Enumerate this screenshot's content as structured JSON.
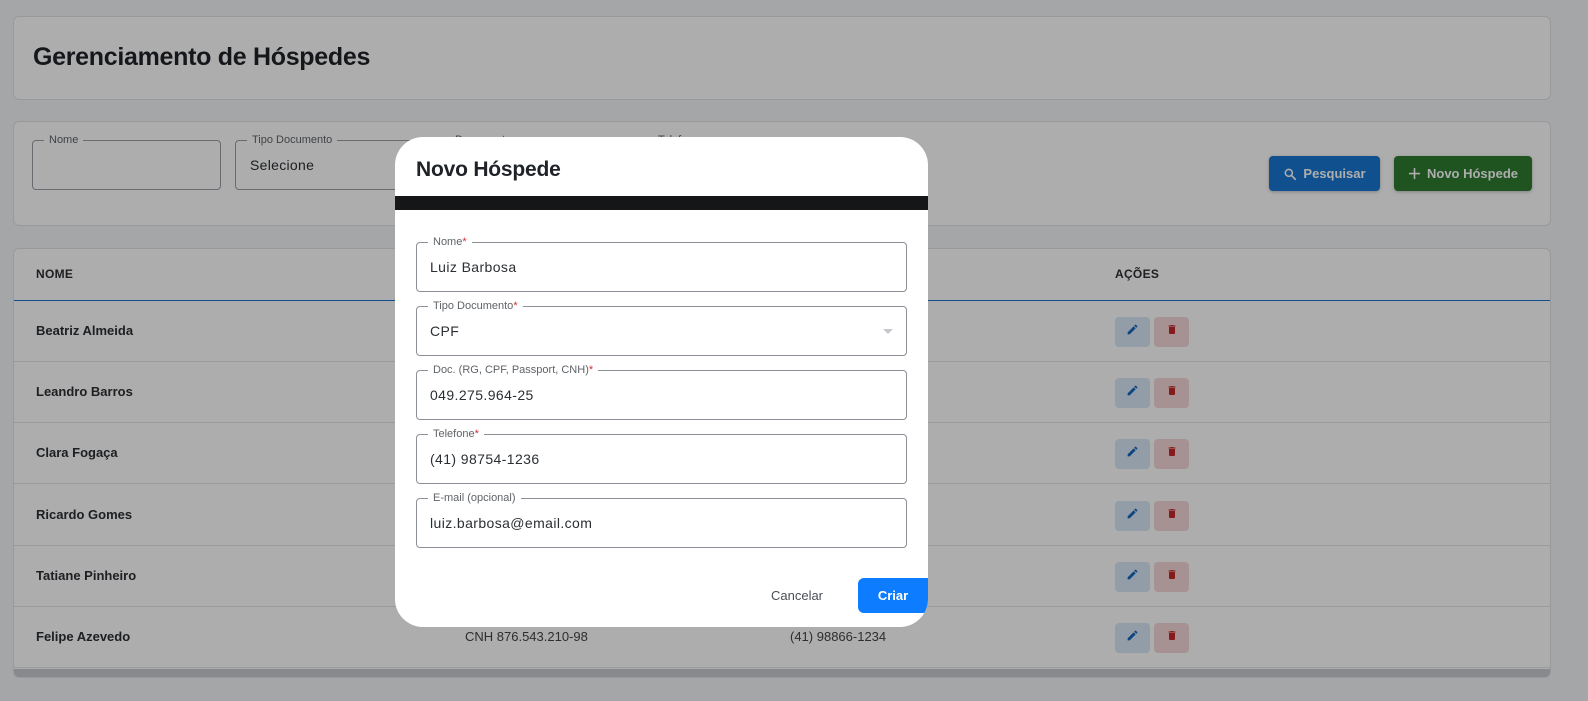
{
  "page": {
    "title": "Gerenciamento de Hóspedes"
  },
  "filters": {
    "nome": {
      "label": "Nome",
      "value": ""
    },
    "tipo_documento": {
      "label": "Tipo Documento",
      "value": "Selecione"
    },
    "documento": {
      "label": "Documento",
      "value": ""
    },
    "telefone": {
      "label": "Telefone",
      "value": ""
    },
    "search_label": "Pesquisar",
    "new_label": "Novo Hóspede"
  },
  "table": {
    "columns": {
      "nome": "NOME",
      "acoes": "AÇÕES"
    },
    "rows": [
      {
        "nome": "Beatriz Almeida",
        "documento": "",
        "telefone": ""
      },
      {
        "nome": "Leandro Barros",
        "documento": "",
        "telefone": ""
      },
      {
        "nome": "Clara Fogaça",
        "documento": "",
        "telefone": ""
      },
      {
        "nome": "Ricardo Gomes",
        "documento": "",
        "telefone": ""
      },
      {
        "nome": "Tatiane Pinheiro",
        "documento": "",
        "telefone": ""
      },
      {
        "nome": "Felipe Azevedo",
        "documento": "CNH 876.543.210-98",
        "telefone": "(41) 98866-1234"
      }
    ]
  },
  "modal": {
    "title": "Novo Hóspede",
    "fields": {
      "nome": {
        "label": "Nome",
        "required": "*",
        "value": "Luiz Barbosa"
      },
      "tipo_documento": {
        "label": "Tipo Documento",
        "required": "*",
        "value": "CPF"
      },
      "documento": {
        "label": "Doc. (RG, CPF, Passport, CNH)",
        "required": "*",
        "value": "049.275.964-25"
      },
      "telefone": {
        "label": "Telefone",
        "required": "*",
        "value": "(41) 98754-1236"
      },
      "email": {
        "label": "E-mail (opcional)",
        "value": "luiz.barbosa@email.com"
      }
    },
    "cancel_label": "Cancelar",
    "create_label": "Criar"
  },
  "colors": {
    "primary": "#1976d2",
    "success": "#2e7d32",
    "danger": "#d32f2f",
    "create_button": "#0d7cff"
  }
}
